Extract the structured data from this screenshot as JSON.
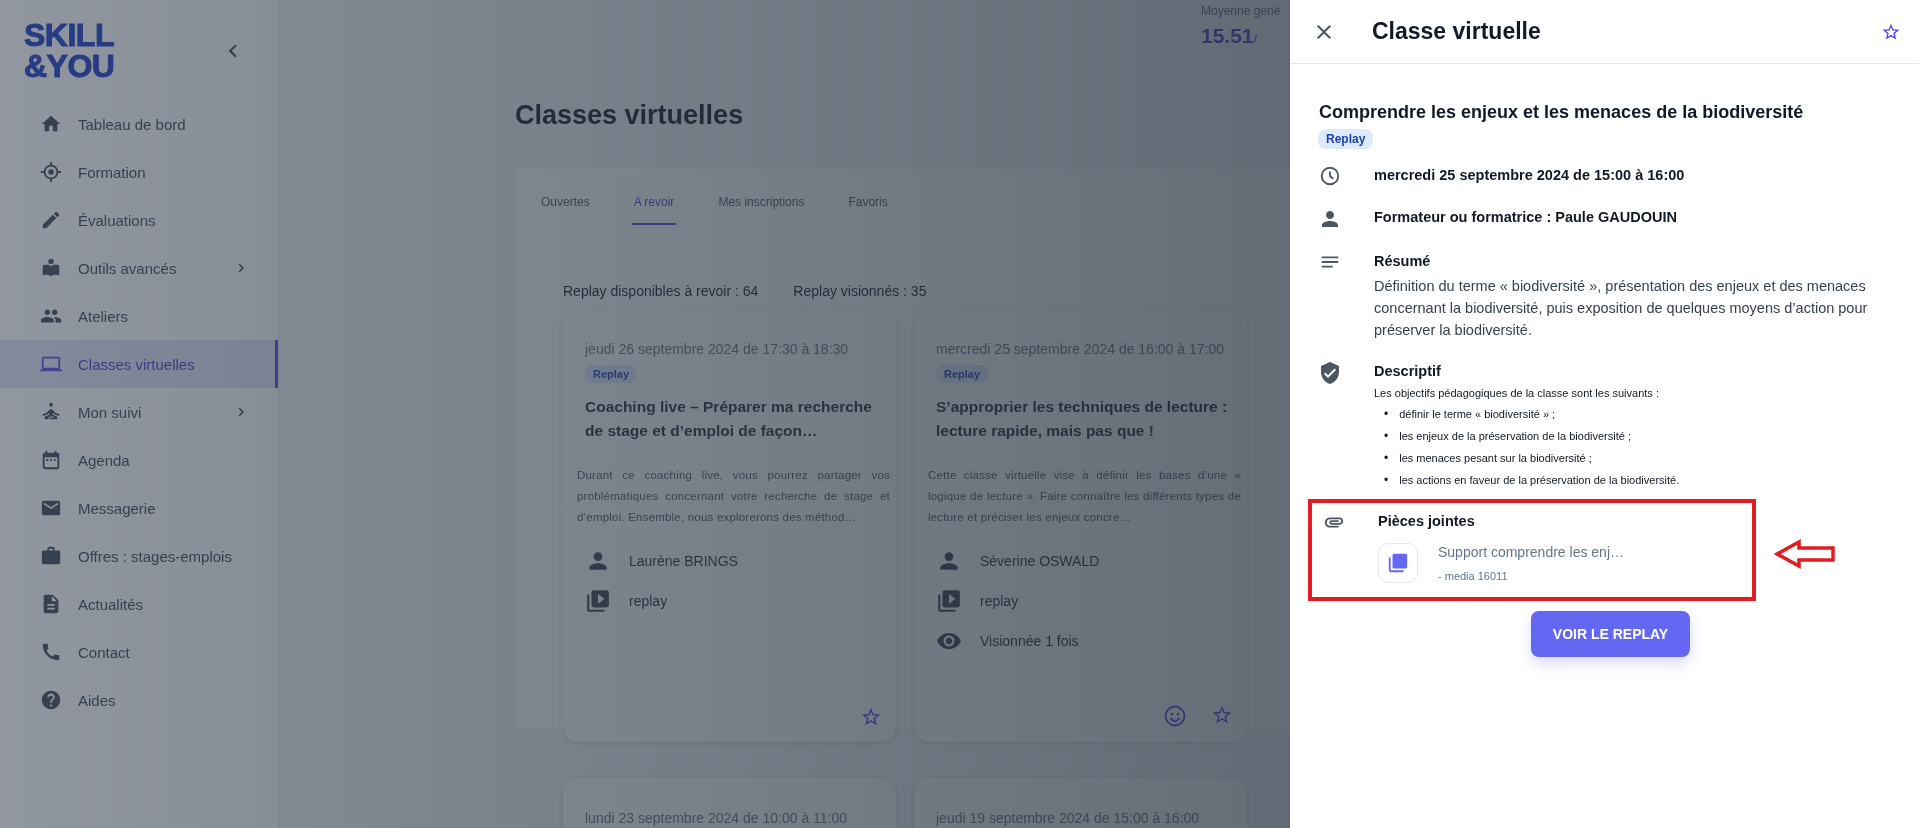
{
  "sidebar": {
    "logo": [
      "SKILL",
      "&YOU"
    ],
    "items": [
      {
        "label": "Tableau de bord",
        "selected": false,
        "has_submenu": false
      },
      {
        "label": "Formation",
        "selected": false,
        "has_submenu": false
      },
      {
        "label": "Évaluations",
        "selected": false,
        "has_submenu": false
      },
      {
        "label": "Outils avancés",
        "selected": false,
        "has_submenu": true
      },
      {
        "label": "Ateliers",
        "selected": false,
        "has_submenu": false
      },
      {
        "label": "Classes virtuelles",
        "selected": true,
        "has_submenu": false
      },
      {
        "label": "Mon suivi",
        "selected": false,
        "has_submenu": true
      },
      {
        "label": "Agenda",
        "selected": false,
        "has_submenu": false
      },
      {
        "label": "Messagerie",
        "selected": false,
        "has_submenu": false
      },
      {
        "label": "Offres : stages-emplois",
        "selected": false,
        "has_submenu": false
      },
      {
        "label": "Actualités",
        "selected": false,
        "has_submenu": false
      },
      {
        "label": "Contact",
        "selected": false,
        "has_submenu": false
      },
      {
        "label": "Aides",
        "selected": false,
        "has_submenu": false
      }
    ]
  },
  "average": {
    "label": "Moyenne géné",
    "value": "15.51",
    "suffix": "/"
  },
  "page_title": "Classes virtuelles",
  "tabs": [
    {
      "label": "Ouvertes",
      "selected": false
    },
    {
      "label": "A revoir",
      "selected": true
    },
    {
      "label": "Mes inscriptions",
      "selected": false
    },
    {
      "label": "Favoris",
      "selected": false
    }
  ],
  "stats": [
    "Replay disponibles à revoir : 64",
    "Replay visionnés : 35"
  ],
  "cards": [
    {
      "date": "jeudi 26 septembre 2024 de 17:30 à 18:30",
      "badge": "Replay",
      "title": "Coaching live – Préparer ma recherche de stage et d’emploi de façon…",
      "description": "Durant ce coaching live, vous pourrez partager vos problématiques concernant votre recherche de stage et d’emploi. Ensemble, nous explorerons des méthod…",
      "trainer": "Laurène BRINGS",
      "media": "replay",
      "favorite": false,
      "feedback": false
    },
    {
      "date": "mercredi 25 septembre 2024 de 16:00 à 17:00",
      "badge": "Replay",
      "title": "S’approprier les techniques de lecture : lecture rapide, mais pas que !",
      "description": "Cette classe virtuelle vise à définir les bases d’une « logique de lecture ». Faire connaître les différents types de lecture et préciser les enjeux concre…",
      "trainer": "Séverine OSWALD",
      "media": "replay",
      "views": "Visionnée 1 fois",
      "favorite": false,
      "feedback": true
    }
  ],
  "more_cards": [
    {
      "date": "lundi 23 septembre 2024 de 10:00 à 11:00"
    },
    {
      "date": "jeudi 19 septembre 2024 de 15:00 à 16:00"
    }
  ],
  "panel": {
    "title": "Classe virtuelle",
    "favorite": false,
    "course_title": "Comprendre les enjeux et les menaces de la biodiversité",
    "badge": "Replay",
    "date": "mercredi 25 septembre 2024 de 15:00 à 16:00",
    "trainer": "Formateur ou formatrice : Paule GAUDOUIN",
    "summary": {
      "heading": "Résumé",
      "text": "Définition du terme « biodiversité », présentation des enjeux et des menaces concernant la biodiversité, puis exposition de quelques moyens d’action pour préserver la biodiversité."
    },
    "description": {
      "heading": "Descriptif",
      "intro": "Les objectifs pédagogiques de la classe sont les suivants :",
      "bullets": [
        {
          "marker": "•",
          "text": "définir le terme « biodiversité » ;"
        },
        {
          "marker": "•",
          "text": "les enjeux de la préservation de la biodiversité ;"
        },
        {
          "marker": "•",
          "text": "les menaces pesant sur la biodiversité ;"
        },
        {
          "marker": "•",
          "text": "les actions en faveur de la préservation de la biodiversité."
        }
      ]
    },
    "attachments": {
      "heading": "Pièces jointes",
      "highlighted": true,
      "files": [
        {
          "name": "Support comprendre les enj…",
          "meta": "- media 16011"
        }
      ]
    },
    "button": "VOIR LE REPLAY"
  }
}
